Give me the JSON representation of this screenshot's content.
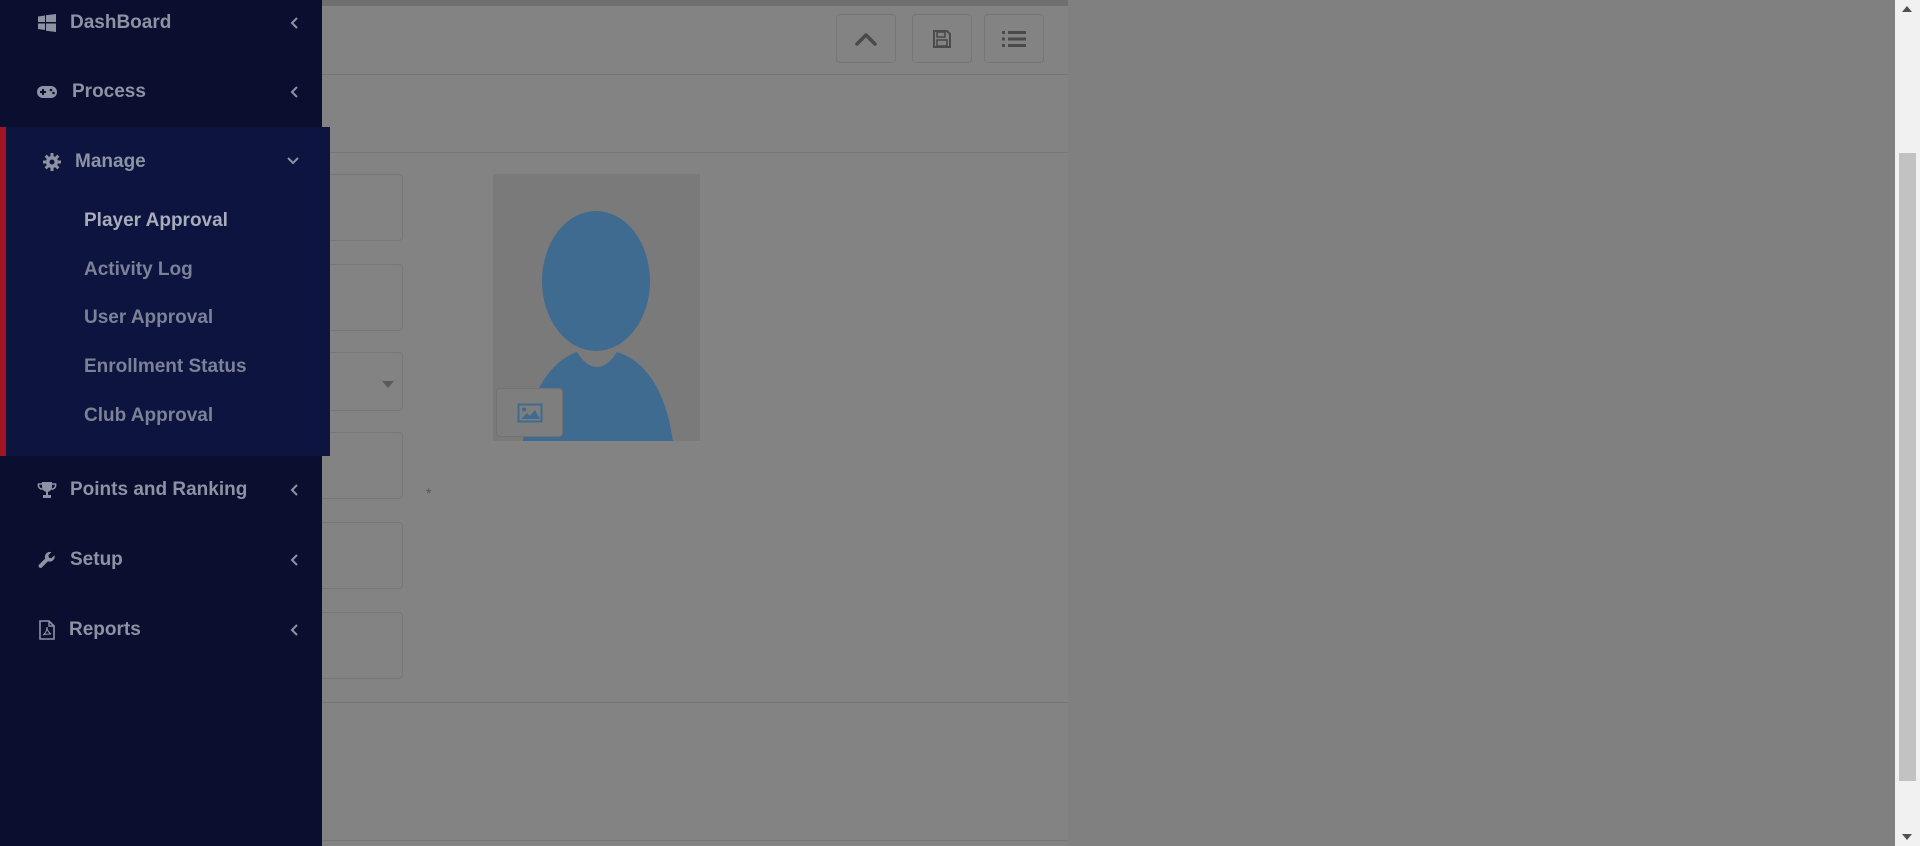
{
  "sidebar": {
    "items": [
      {
        "label": "DashBoard",
        "icon": "windows-icon"
      },
      {
        "label": "Process",
        "icon": "gamepad-icon"
      },
      {
        "label": "Manage",
        "icon": "gear-icon",
        "expanded": true,
        "children": [
          {
            "label": "Player Approval",
            "active": true
          },
          {
            "label": "Activity Log"
          },
          {
            "label": "User Approval"
          },
          {
            "label": "Enrollment Status"
          },
          {
            "label": "Club Approval"
          }
        ]
      },
      {
        "label": "Points and Ranking",
        "icon": "trophy-icon"
      },
      {
        "label": "Setup",
        "icon": "wrench-icon"
      },
      {
        "label": "Reports",
        "icon": "pdf-file-icon"
      }
    ]
  },
  "form": {
    "required_marker": "*"
  },
  "colors": {
    "sidebar_bg": "#0a0f30",
    "active_section_bg": "#0d1440",
    "active_accent": "#a11423",
    "overlay": "#808080",
    "avatar": "#3f6b90"
  }
}
